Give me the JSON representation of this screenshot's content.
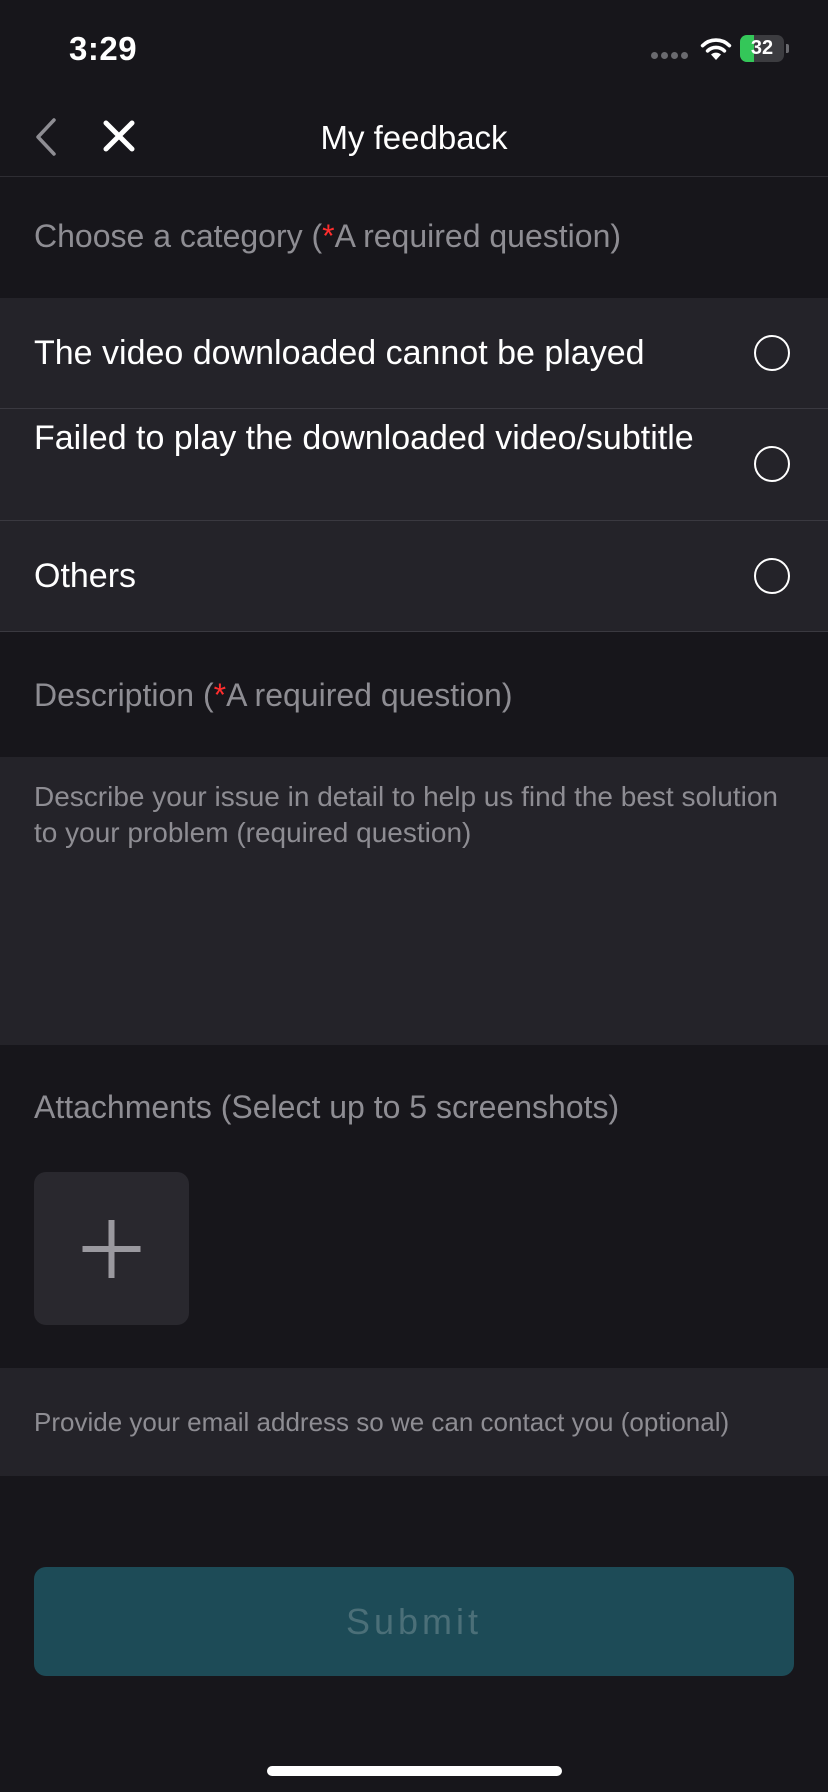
{
  "status_bar": {
    "time": "3:29",
    "battery_level": "32",
    "battery_fraction": 0.32
  },
  "nav": {
    "title": "My feedback",
    "back_icon": "chevron-left-icon",
    "close_icon": "close-icon"
  },
  "category": {
    "label_prefix": "Choose a category (",
    "required_mark": "*",
    "label_suffix": "A required question)",
    "options": [
      {
        "label": "The video downloaded cannot be played",
        "selected": false
      },
      {
        "label": "Failed to play the downloaded video/subtitle",
        "selected": false
      },
      {
        "label": "Others",
        "selected": false
      }
    ]
  },
  "description": {
    "label_prefix": "Description (",
    "required_mark": "*",
    "label_suffix": "A required question)",
    "placeholder": "Describe your issue in detail to help us find the best solution to your problem (required question)",
    "value": ""
  },
  "attachments": {
    "label": "Attachments (Select up to 5 screenshots)",
    "add_icon": "plus-icon"
  },
  "email": {
    "placeholder": "Provide your email address so we can contact you (optional)",
    "value": ""
  },
  "submit": {
    "label": "Submit"
  }
}
